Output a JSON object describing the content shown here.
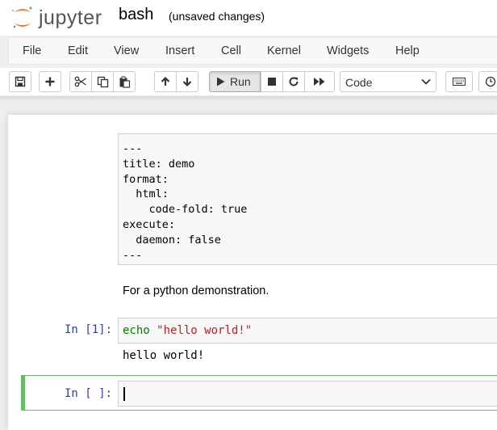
{
  "header": {
    "logo_text": "jupyter",
    "notebook_name": "bash",
    "save_status": "(unsaved changes)"
  },
  "menu": [
    "File",
    "Edit",
    "View",
    "Insert",
    "Cell",
    "Kernel",
    "Widgets",
    "Help"
  ],
  "toolbar": {
    "run_label": "Run",
    "cell_type": "Code"
  },
  "cells": {
    "raw_lines": [
      "---",
      "title: demo",
      "format:",
      "  html:",
      "    code-fold: true",
      "execute:",
      "  daemon: false",
      "---"
    ],
    "markdown_text": "For a python demonstration.",
    "code1_prompt": "In [1]:",
    "code1_keyword": "echo",
    "code1_string": "\"hello world!\"",
    "code1_output": "hello world!",
    "code2_prompt": "In [ ]:"
  },
  "colors": {
    "prompt": "#303f9f",
    "selected_border": "#66bb6a",
    "keyword": "#008000",
    "string": "#ba2121",
    "logo_orange": "#f37726"
  }
}
